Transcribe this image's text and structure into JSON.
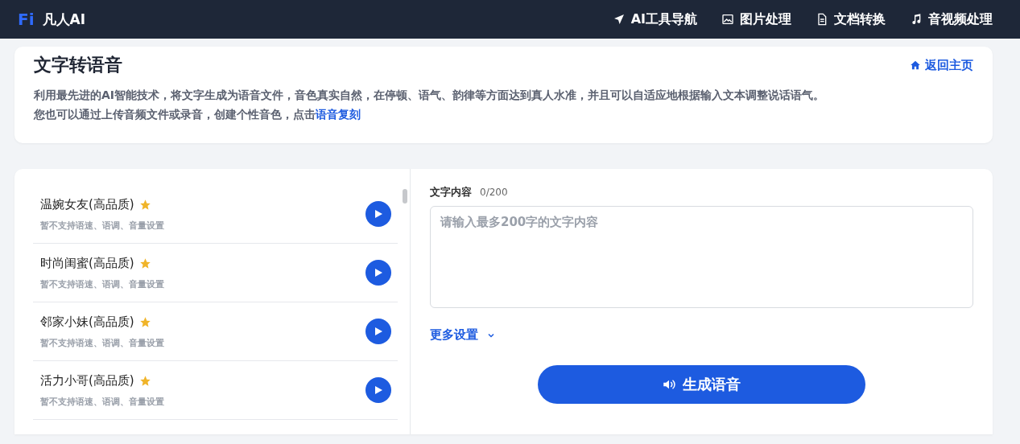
{
  "nav": {
    "logo_mark": "Fi",
    "brand": "凡人AI",
    "links": [
      {
        "label": "AI工具导航"
      },
      {
        "label": "图片处理"
      },
      {
        "label": "文档转换"
      },
      {
        "label": "音视频处理"
      }
    ]
  },
  "header": {
    "title": "文字转语音",
    "back_link": "返回主页",
    "description": "利用最先进的AI智能技术，将文字生成为语音文件，音色真实自然，在停顿、语气、韵律等方面达到真人水准，并且可以自适应地根据输入文本调整说话语气。",
    "description_2": "您也可以通过上传音频文件或录音，创建个性音色，点击",
    "description_link": "语音复刻"
  },
  "voices": [
    {
      "name": "温婉女友(高品质)",
      "starred": true,
      "note": "暂不支持语速、语调、音量设置"
    },
    {
      "name": "时尚闺蜜(高品质)",
      "starred": true,
      "note": "暂不支持语速、语调、音量设置"
    },
    {
      "name": "邻家小妹(高品质)",
      "starred": true,
      "note": "暂不支持语速、语调、音量设置"
    },
    {
      "name": "活力小哥(高品质)",
      "starred": true,
      "note": "暂不支持语速、语调、音量设置"
    }
  ],
  "editor": {
    "label": "文字内容",
    "counter": "0/200",
    "placeholder": "请输入最多200字的文字内容",
    "more_settings": "更多设置",
    "expanded": false,
    "submit": "生成语音"
  }
}
